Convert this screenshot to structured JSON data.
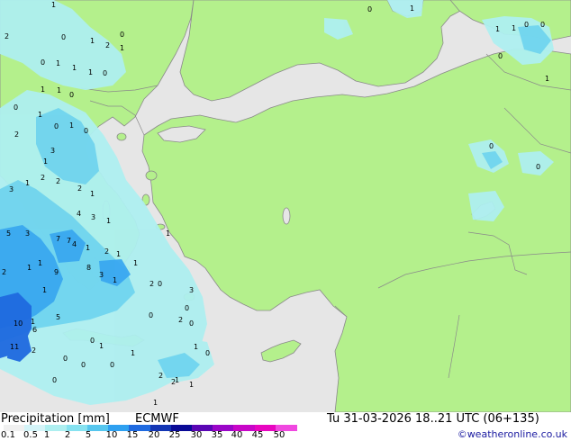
{
  "map": {
    "colors": {
      "sea": "#e6e6e6",
      "land": "#b4f08c",
      "border": "#8a8a8a",
      "precip_light": "#aeeff0",
      "precip_mid": "#70d4ee",
      "precip_high": "#3aa8f0",
      "precip_max": "#1f6ae0"
    },
    "precip_labels": [
      {
        "v": "1"
      },
      {
        "v": "0"
      },
      {
        "v": "1"
      },
      {
        "v": "2"
      },
      {
        "v": "1"
      },
      {
        "v": "0"
      },
      {
        "v": "2"
      },
      {
        "v": "0"
      },
      {
        "v": "1"
      },
      {
        "v": "1"
      },
      {
        "v": "1"
      },
      {
        "v": "0"
      },
      {
        "v": "1"
      },
      {
        "v": "0"
      },
      {
        "v": "1"
      },
      {
        "v": "0"
      },
      {
        "v": "1"
      },
      {
        "v": "2"
      },
      {
        "v": "0"
      },
      {
        "v": "1"
      },
      {
        "v": "0"
      },
      {
        "v": "3"
      },
      {
        "v": "1"
      },
      {
        "v": "2"
      },
      {
        "v": "3"
      },
      {
        "v": "1"
      },
      {
        "v": "2"
      },
      {
        "v": "2"
      },
      {
        "v": "1"
      },
      {
        "v": "4"
      },
      {
        "v": "3"
      },
      {
        "v": "1"
      },
      {
        "v": "7"
      },
      {
        "v": "7"
      },
      {
        "v": "4"
      },
      {
        "v": "1"
      },
      {
        "v": "2"
      },
      {
        "v": "1"
      },
      {
        "v": "5"
      },
      {
        "v": "3"
      },
      {
        "v": "1"
      },
      {
        "v": "9"
      },
      {
        "v": "2"
      },
      {
        "v": "1"
      },
      {
        "v": "3"
      },
      {
        "v": "1"
      },
      {
        "v": "8"
      },
      {
        "v": "5"
      },
      {
        "v": "6"
      },
      {
        "v": "1"
      },
      {
        "v": "10"
      },
      {
        "v": "2"
      },
      {
        "v": "11"
      },
      {
        "v": "1"
      },
      {
        "v": "0"
      },
      {
        "v": "1"
      },
      {
        "v": "1"
      },
      {
        "v": "0"
      },
      {
        "v": "3"
      },
      {
        "v": "2"
      },
      {
        "v": "0"
      },
      {
        "v": "0"
      },
      {
        "v": "2"
      },
      {
        "v": "0"
      },
      {
        "v": "0"
      },
      {
        "v": "1"
      },
      {
        "v": "0"
      },
      {
        "v": "2"
      },
      {
        "v": "1"
      },
      {
        "v": "0"
      },
      {
        "v": "1"
      },
      {
        "v": "0"
      },
      {
        "v": "1"
      },
      {
        "v": "0"
      },
      {
        "v": "1"
      },
      {
        "v": "2"
      },
      {
        "v": "1"
      },
      {
        "v": "0"
      },
      {
        "v": "1"
      },
      {
        "v": "1"
      },
      {
        "v": "1"
      },
      {
        "v": "0"
      },
      {
        "v": "0"
      },
      {
        "v": "1"
      },
      {
        "v": "0"
      },
      {
        "v": "0"
      },
      {
        "v": "0"
      }
    ]
  },
  "footer": {
    "product": "Precipitation [mm]",
    "model": "ECMWF",
    "valid_time": "Tu 31-03-2026 18..21 UTC (06+135)",
    "credit": "©weatheronline.co.uk",
    "legend": {
      "ticks": [
        "0.1",
        "0.5",
        "1",
        "2",
        "5",
        "10",
        "15",
        "20",
        "25",
        "30",
        "35",
        "40",
        "45",
        "50"
      ],
      "colors": [
        "#f0f0f0",
        "#d4f4f8",
        "#aeeff0",
        "#86e2f0",
        "#56c6ee",
        "#2ea0f0",
        "#1f6ae0",
        "#1436b4",
        "#0a0a96",
        "#5a06b4",
        "#9a06c8",
        "#c806c8",
        "#e806c0",
        "#f048e0"
      ]
    }
  }
}
